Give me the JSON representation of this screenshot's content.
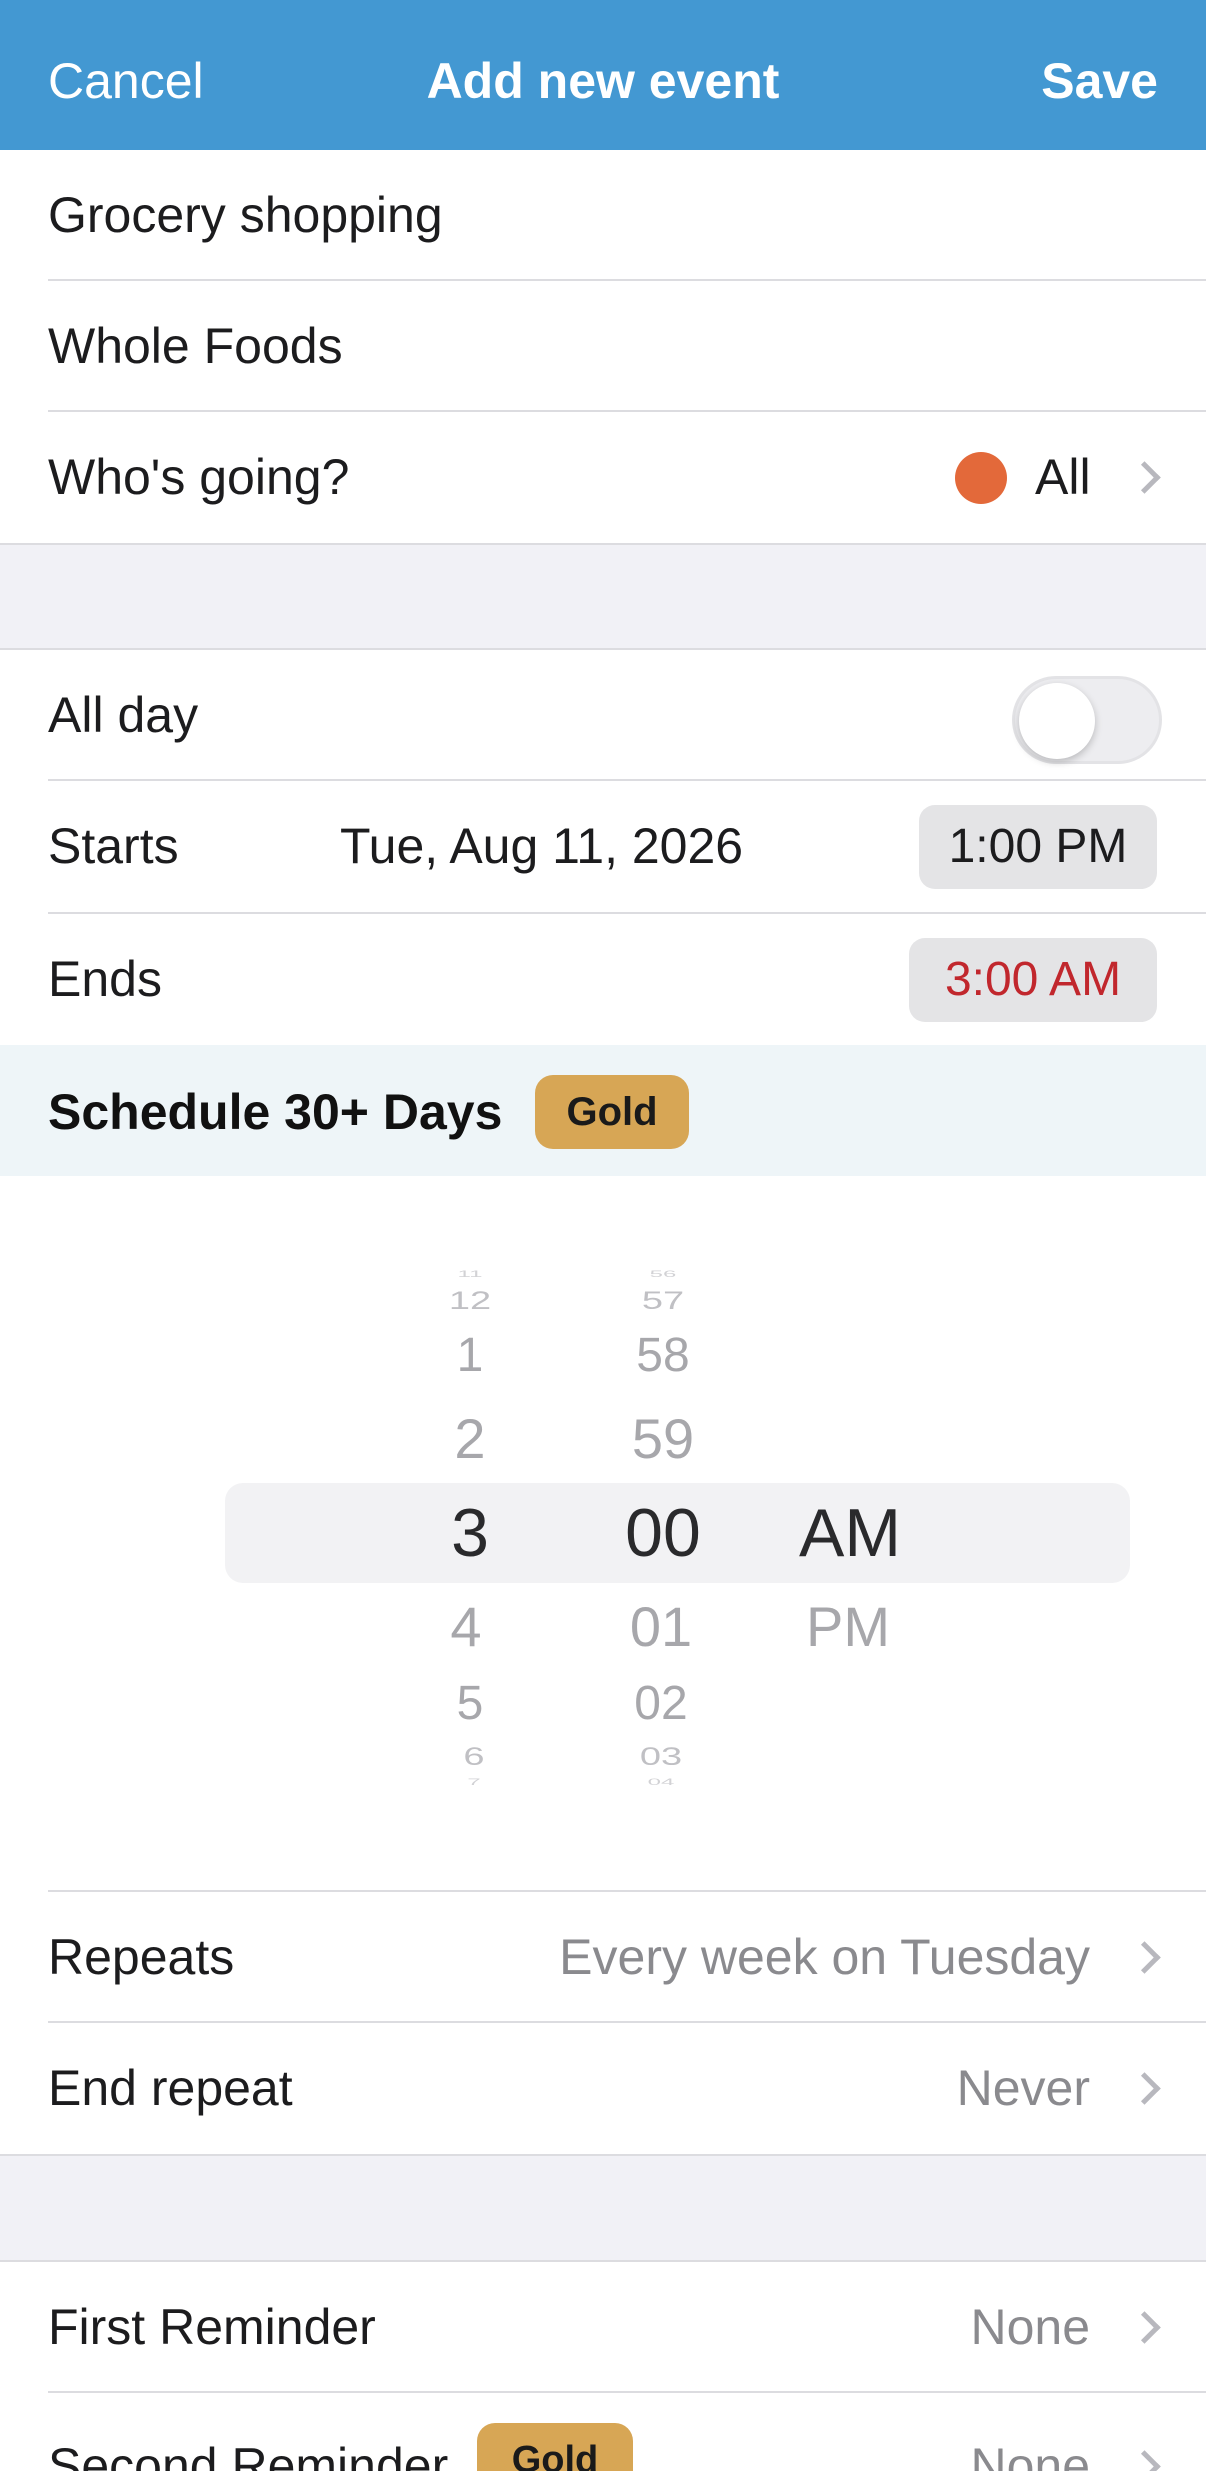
{
  "header": {
    "cancel": "Cancel",
    "title": "Add new event",
    "save": "Save"
  },
  "event": {
    "title": "Grocery shopping",
    "location": "Whole Foods"
  },
  "whos_going": {
    "label": "Who's going?",
    "value": "All",
    "dot_color": "#e3693a"
  },
  "all_day": {
    "label": "All day",
    "enabled": false
  },
  "starts": {
    "label": "Starts",
    "date": "Tue, Aug 11, 2026",
    "time": "1:00 PM"
  },
  "ends": {
    "label": "Ends",
    "time": "3:00 AM",
    "time_color": "#c1272d"
  },
  "promo": {
    "text": "Schedule 30+ Days",
    "badge": "Gold"
  },
  "picker": {
    "hours": [
      "11",
      "12",
      "1",
      "2",
      "3",
      "4",
      "5",
      "6",
      "7"
    ],
    "minutes": [
      "56",
      "57",
      "58",
      "59",
      "00",
      "01",
      "02",
      "03",
      "04"
    ],
    "periods": [
      "AM",
      "PM"
    ],
    "selected": {
      "hour": "3",
      "minute": "00",
      "period": "AM"
    }
  },
  "repeats": {
    "label": "Repeats",
    "value": "Every week on Tuesday"
  },
  "end_repeat": {
    "label": "End repeat",
    "value": "Never"
  },
  "first_reminder": {
    "label": "First Reminder",
    "value": "None"
  },
  "second_reminder": {
    "label": "Second Reminder",
    "badge": "Gold",
    "value": "None"
  },
  "colors": {
    "header": "#4398d2",
    "badge": "#d7a655",
    "background_gap": "#f1f1f6"
  }
}
